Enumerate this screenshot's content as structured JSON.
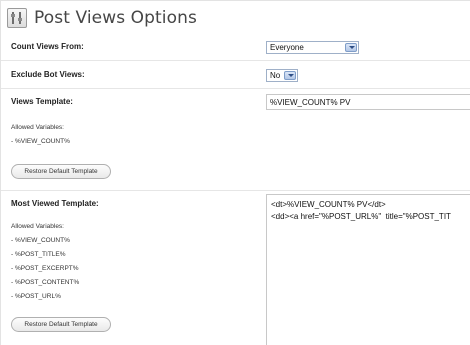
{
  "header": {
    "title": "Post Views Options",
    "icon": "settings-icon"
  },
  "count_views_from": {
    "label": "Count Views From:",
    "value": "Everyone"
  },
  "exclude_bot_views": {
    "label": "Exclude Bot Views:",
    "value": "No"
  },
  "views_template": {
    "label": "Views Template:",
    "value": "%VIEW_COUNT% PV",
    "allowed_title": "Allowed Variables:",
    "allowed": [
      "- %VIEW_COUNT%"
    ],
    "restore_label": "Restore Default Template"
  },
  "most_viewed_template": {
    "label": "Most Viewed Template:",
    "value_lines": [
      "<dt>%VIEW_COUNT% PV</dt>",
      "<dd><a href=\"%POST_URL%\"  title=\"%POST_TIT"
    ],
    "allowed_title": "Allowed Variables:",
    "allowed": [
      "- %VIEW_COUNT%",
      "- %POST_TITLE%",
      "- %POST_EXCERPT%",
      "- %POST_CONTENT%",
      "- %POST_URL%"
    ],
    "restore_label": "Restore Default Template"
  }
}
